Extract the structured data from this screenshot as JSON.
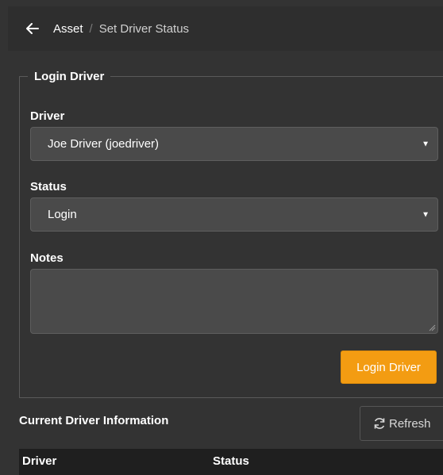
{
  "header": {
    "back_icon": "arrow-left-icon",
    "breadcrumb_root": "Asset",
    "breadcrumb_separator": "/",
    "breadcrumb_current": "Set Driver Status"
  },
  "form": {
    "legend": "Login Driver",
    "driver": {
      "label": "Driver",
      "value": "Joe Driver (joedriver)"
    },
    "status": {
      "label": "Status",
      "value": "Login"
    },
    "notes": {
      "label": "Notes",
      "value": ""
    },
    "submit_label": "Login Driver"
  },
  "current_info": {
    "title": "Current Driver Information",
    "refresh_label": "Refresh",
    "refresh_icon": "refresh-icon",
    "columns": [
      "Driver",
      "Status"
    ]
  },
  "colors": {
    "background": "#333333",
    "header_bg": "#2e2e2e",
    "accent": "#f39c12",
    "input_bg": "#4a4a4a",
    "table_header_bg": "#1f1f1f"
  }
}
